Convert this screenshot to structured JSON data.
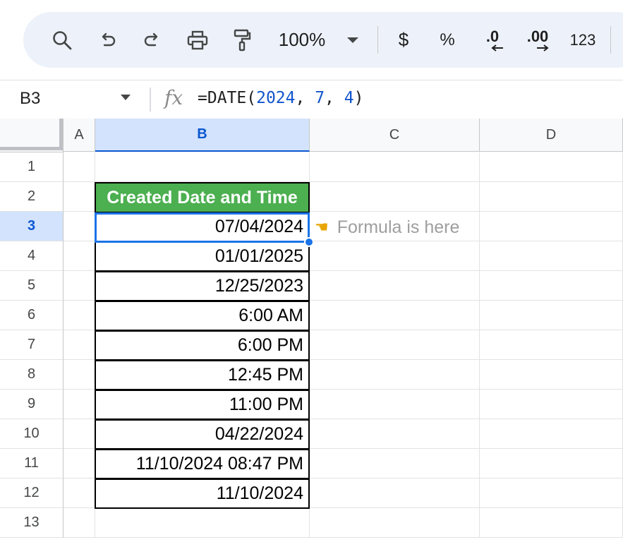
{
  "toolbar": {
    "zoom": "100%",
    "currency_label": "$",
    "percent_label": "%",
    "decrease_decimal_label": ".0",
    "increase_decimal_label": ".00",
    "number_format_label": "123",
    "icons": [
      "search-icon",
      "undo-icon",
      "redo-icon",
      "print-icon",
      "paint-format-icon",
      "chevron-down-icon",
      "arrow-left-icon",
      "arrow-right-icon"
    ]
  },
  "formula_bar": {
    "name_box": "B3",
    "fx_label": "fx",
    "formula_prefix": "=DATE(",
    "arg1": "2024",
    "sep1": ", ",
    "arg2": "7",
    "sep2": ", ",
    "arg3": "4",
    "formula_suffix": ")"
  },
  "columns": [
    "A",
    "B",
    "C",
    "D"
  ],
  "selected_column": "B",
  "rows": [
    "1",
    "2",
    "3",
    "4",
    "5",
    "6",
    "7",
    "8",
    "9",
    "10",
    "11",
    "12",
    "13"
  ],
  "selected_row": "3",
  "table": {
    "header": "Created Date and Time",
    "values": [
      "07/04/2024",
      "01/01/2025",
      "12/25/2023",
      "6:00 AM",
      "6:00 PM",
      "12:45 PM",
      "11:00 PM",
      "04/22/2024",
      "11/10/2024 08:47 PM",
      "11/10/2024"
    ]
  },
  "annotation": {
    "text": "Formula is here",
    "icon": "pointing-hand-icon"
  },
  "colors": {
    "header_fill": "#4caf50",
    "selection": "#1a73e8",
    "toolbar_bg": "#edf2fa",
    "annotation_text": "#9e9e9e"
  }
}
